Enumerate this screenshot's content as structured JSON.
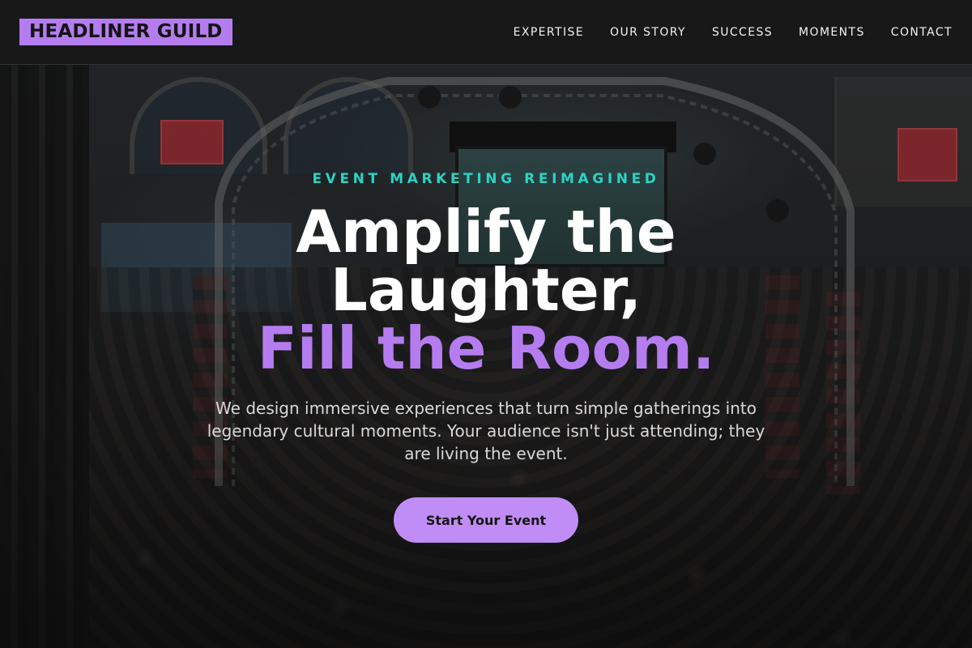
{
  "header": {
    "logo_text": "HEADLINER GUILD",
    "nav": [
      {
        "label": "EXPERTISE"
      },
      {
        "label": "OUR STORY"
      },
      {
        "label": "SUCCESS"
      },
      {
        "label": "MOMENTS"
      },
      {
        "label": "CONTACT"
      }
    ]
  },
  "hero": {
    "eyebrow": "EVENT MARKETING REIMAGINED",
    "headline_line1": "Amplify the",
    "headline_line2": "Laughter,",
    "headline_accent": "Fill the Room.",
    "subtext": "We design immersive experiences that turn simple gatherings into legendary cultural moments. Your audience isn't just attending; they are living the event.",
    "cta_label": "Start Your Event",
    "background_image": "event-crowd-photo"
  },
  "colors": {
    "accent_purple": "#b57cf0",
    "accent_teal": "#2ad4c4",
    "header_bg": "#181818",
    "text_light": "#ffffff"
  }
}
